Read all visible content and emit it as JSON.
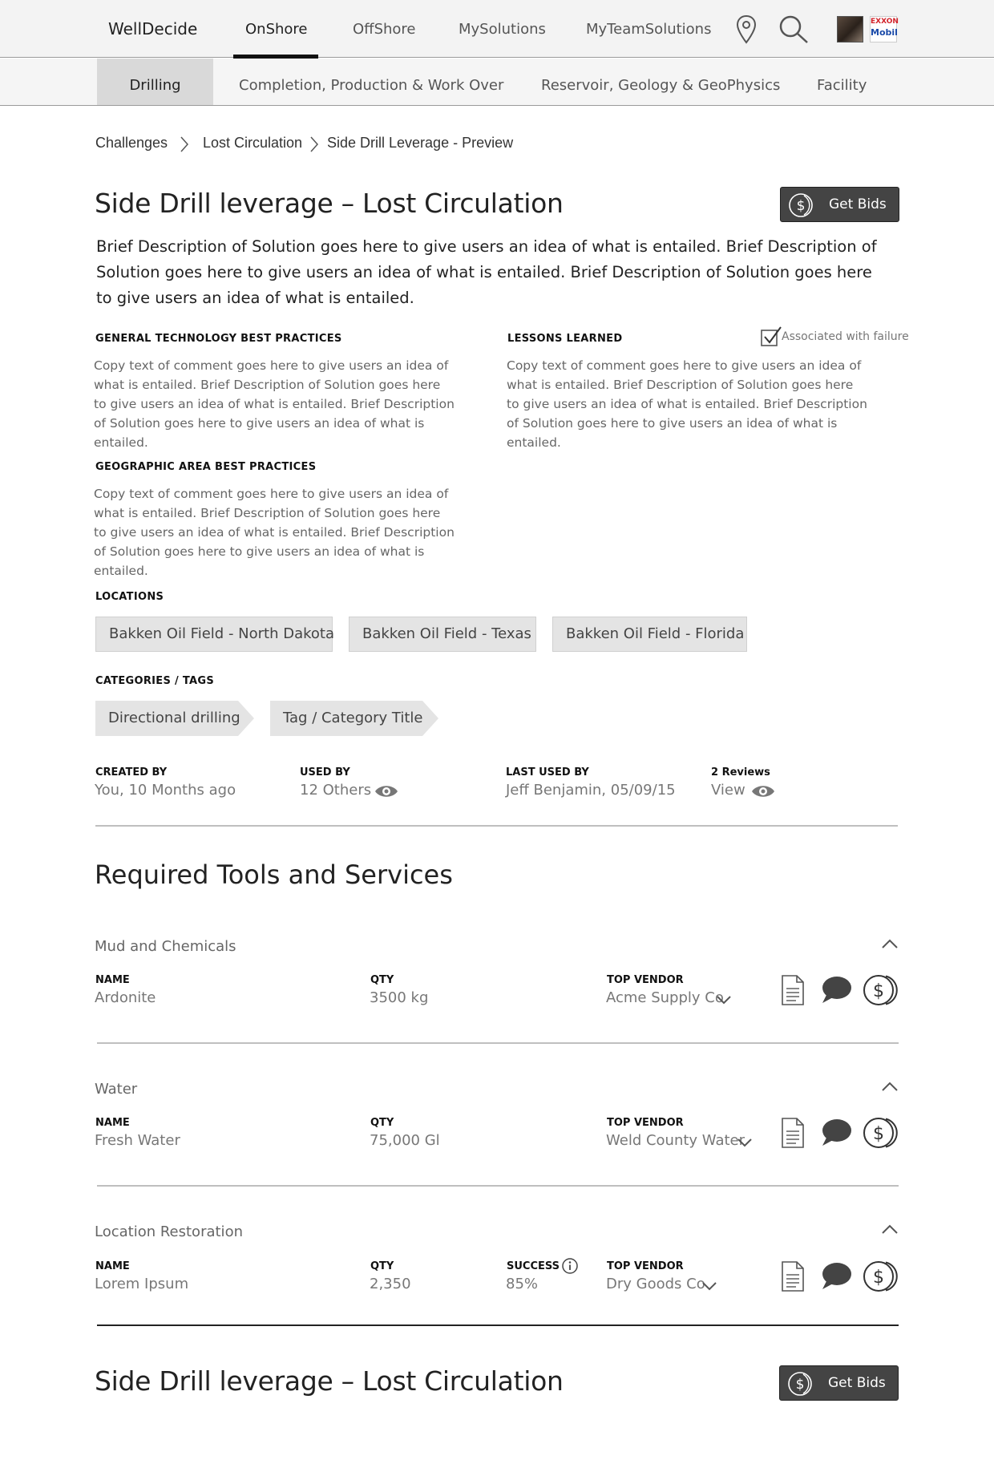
{
  "nav": {
    "brand": "WellDecide",
    "links": [
      "OnShore",
      "OffShore",
      "MySolutions",
      "MyTeamSolutions"
    ],
    "active": "OnShore",
    "logo_top": "EXXON",
    "logo_bottom": "Mobil"
  },
  "subnav": {
    "tabs": [
      "Drilling",
      "Completion, Production & Work Over",
      "Reservoir, Geology & GeoPhysics",
      "Facility"
    ],
    "active": "Drilling"
  },
  "breadcrumb": [
    "Challenges",
    "Lost Circulation",
    "Side Drill Leverage - Preview"
  ],
  "title": "Side Drill leverage – Lost Circulation",
  "get_bids_label": "Get Bids",
  "description": "Brief Description of Solution goes here to give users an idea of what is entailed. Brief Description of Solution goes here to give users an idea of what is entailed. Brief Description of Solution goes here to give users an idea of what is entailed.",
  "sections": {
    "general": {
      "heading": "GENERAL TECHNOLOGY BEST PRACTICES",
      "text": "Copy text of comment goes here to give users an idea of what is entailed. Brief Description of Solution goes here to give users an idea of what is entailed. Brief Description of Solution goes here to give users an idea of what is entailed."
    },
    "lessons": {
      "heading": "LESSONS LEARNED",
      "text": "Copy text of comment goes here to give users an idea of what is entailed. Brief Description of Solution goes here to give users an idea of what is entailed. Brief Description of Solution goes here to give users an idea of what is entailed.",
      "associated_label": "Associated with failure",
      "associated_checked": true
    },
    "geographic": {
      "heading": "GEOGRAPHIC AREA BEST PRACTICES",
      "text": "Copy text of comment goes here to give users an idea of what is entailed. Brief Description of Solution goes here to give users an idea of what is entailed. Brief Description of Solution goes here to give users an idea of what is entailed."
    }
  },
  "locations": {
    "heading": "LOCATIONS",
    "items": [
      "Bakken Oil Field - North Dakota",
      "Bakken Oil Field - Texas",
      "Bakken Oil Field - Florida"
    ]
  },
  "categories": {
    "heading": "CATEGORIES / TAGS",
    "items": [
      "Directional drilling",
      "Tag / Category Title"
    ]
  },
  "meta": {
    "created_by_label": "CREATED BY",
    "created_by": "You, 10 Months ago",
    "used_by_label": "USED BY",
    "used_by": "12 Others",
    "last_used_label": "LAST USED BY",
    "last_used": "Jeff Benjamin, 05/09/15",
    "reviews_label": "2 Reviews",
    "reviews_action": "View"
  },
  "tools_heading": "Required Tools and Services",
  "labels": {
    "name": "NAME",
    "qty": "QTY",
    "success": "SUCCESS",
    "top_vendor": "TOP VENDOR"
  },
  "tool_groups": [
    {
      "title": "Mud and Chemicals",
      "name": "Ardonite",
      "qty": "3500 kg",
      "vendor": "Acme Supply Co"
    },
    {
      "title": "Water",
      "name": "Fresh Water",
      "qty": "75,000 Gl",
      "vendor": "Weld County Water"
    },
    {
      "title": "Location Restoration",
      "name": "Lorem Ipsum",
      "qty": "2,350",
      "success": "85%",
      "vendor": "Dry Goods Co"
    }
  ],
  "footer_title": "Side Drill leverage – Lost Circulation",
  "footer_get_bids_label": "Get Bids",
  "colors": {
    "button_bg": "#444444",
    "nav_active_underline": "#111111",
    "chip_bg": "#e4e4e4",
    "subnav_active_bg": "#d9d9d9"
  }
}
